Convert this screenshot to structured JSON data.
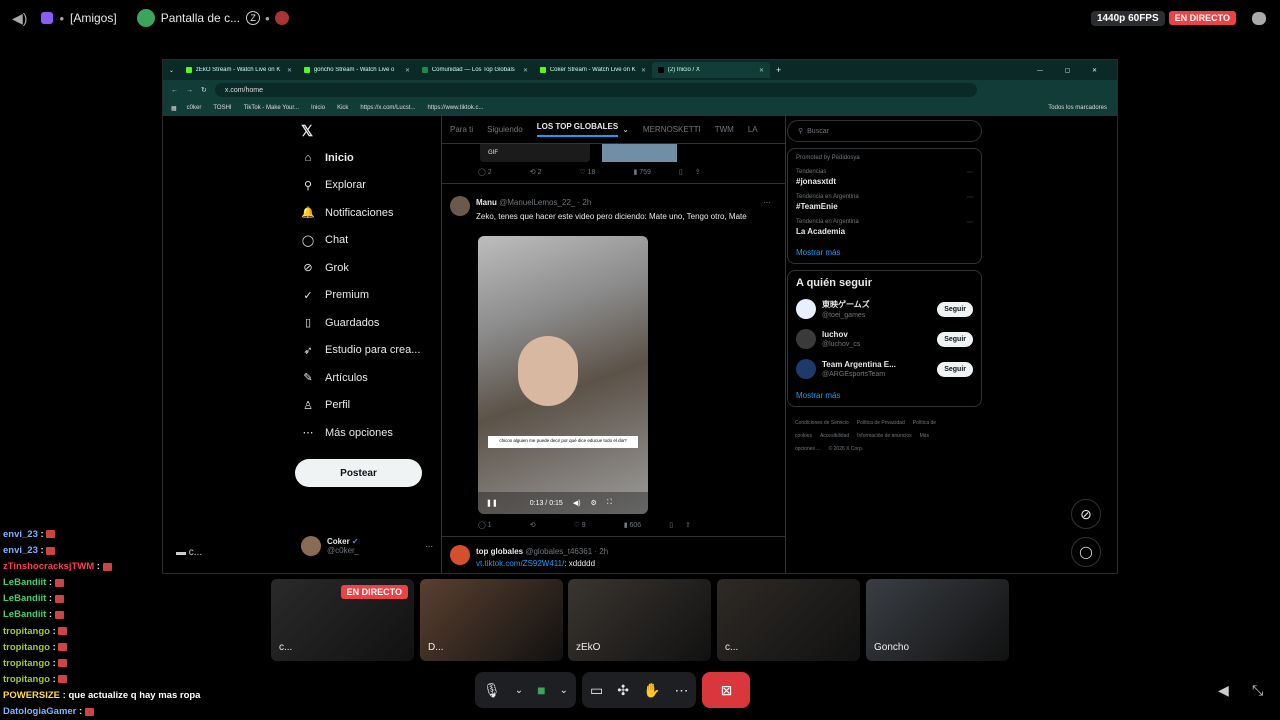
{
  "topbar": {
    "server": "[Amigos]",
    "channel": "Pantalla de c...",
    "quality": "1440p 60FPS",
    "live": "EN DIRECTO"
  },
  "browser": {
    "tabs": [
      {
        "label": "zEkO Stream - Watch Live on K",
        "fav": "#53fc18"
      },
      {
        "label": "goncho Stream - Watch Live o",
        "fav": "#53fc18"
      },
      {
        "label": "Comunidad — Los Top Globals",
        "fav": "#1a8a4a"
      },
      {
        "label": "Coker Stream - Watch Live on K",
        "fav": "#53fc18"
      },
      {
        "label": "(2) Inicio / X",
        "fav": "#000000"
      }
    ],
    "url": "x.com/home",
    "bookmarks": [
      "c0ker",
      "TOSHI",
      "TikTok - Make Your...",
      "Inicio",
      "Kick",
      "https://x.com/Lucst...",
      "https://www.tiktok.c..."
    ],
    "all_bookmarks": "Todos los marcadores"
  },
  "x": {
    "nav": [
      {
        "label": "Inicio",
        "icon": "home-icon",
        "glyph": "⌂"
      },
      {
        "label": "Explorar",
        "icon": "search-icon",
        "glyph": "⚲"
      },
      {
        "label": "Notificaciones",
        "icon": "bell-icon",
        "glyph": "🔔"
      },
      {
        "label": "Chat",
        "icon": "chat-icon",
        "glyph": "◯"
      },
      {
        "label": "Grok",
        "icon": "grok-icon",
        "glyph": "⊘"
      },
      {
        "label": "Premium",
        "icon": "premium-icon",
        "glyph": "✓"
      },
      {
        "label": "Guardados",
        "icon": "bookmark-icon",
        "glyph": "▯"
      },
      {
        "label": "Estudio para crea...",
        "icon": "rocket-icon",
        "glyph": "➶"
      },
      {
        "label": "Artículos",
        "icon": "article-icon",
        "glyph": "✎"
      },
      {
        "label": "Perfil",
        "icon": "profile-icon",
        "glyph": "♙"
      },
      {
        "label": "Más opciones",
        "icon": "more-icon",
        "glyph": "⋯"
      }
    ],
    "post_button": "Postear",
    "profile_name": "Coker",
    "profile_handle": "@c0ker_",
    "feed_tabs": [
      "Para ti",
      "Siguiendo",
      "LOS TOP GLOBALES",
      "MERNOSKETTI",
      "TWM",
      "LA"
    ],
    "active_tab": 2,
    "top_gif": "GIF",
    "top_actions": [
      "2",
      "2",
      "18",
      "759"
    ],
    "tweet1": {
      "name": "Manu",
      "handle": "@ManuelLemos_22_ · 2h",
      "text": "Zeko, tenes que hacer este video pero diciendo: Mate uno, Tengo otro, Mate",
      "caption": "chicos alguien me puede decir por qué dice educue todo el dia?",
      "time": "0:13 / 0:15",
      "actions": [
        "1",
        "",
        "9",
        "606"
      ]
    },
    "tweet2": {
      "name": "top globales",
      "handle": "@globales_t46361 · 2h",
      "link": "vt.tiktok.com/ZS92W411/",
      "text": ": xddddd"
    },
    "search_placeholder": "Buscar",
    "promoted": "Promoted by Pedidosya",
    "trends": [
      {
        "cat": "Tendencias",
        "tag": "#jonasxtdt"
      },
      {
        "cat": "Tendencia en Argentina",
        "tag": "#TeamEnie"
      },
      {
        "cat": "Tendencia en Argentina",
        "tag": "La Academia"
      }
    ],
    "show_more": "Mostrar más",
    "who_follow": "A quién seguir",
    "suggestions": [
      {
        "name": "東映ゲームズ",
        "handle": "@toei_games"
      },
      {
        "name": "luchov",
        "handle": "@luchov_cs"
      },
      {
        "name": "Team Argentina E...",
        "handle": "@ARGEsportsTeam"
      }
    ],
    "follow_label": "Seguir",
    "footer": [
      "Condiciones de Servicio",
      "Política de Privacidad",
      "Política de cookies",
      "Accesibilidad",
      "Información de anuncios",
      "Más opciones ...",
      "© 2026 X Corp."
    ]
  },
  "chat": [
    {
      "user": "envi_23",
      "color": "#7fb3ff",
      "msg": ""
    },
    {
      "user": "envi_23",
      "color": "#7fb3ff",
      "msg": ""
    },
    {
      "user": "zTinshocracksjTWM",
      "color": "#ff3b5c",
      "msg": ""
    },
    {
      "user": "LeBandiit",
      "color": "#3cd070",
      "msg": ""
    },
    {
      "user": "LeBandiit",
      "color": "#3cd070",
      "msg": ""
    },
    {
      "user": "LeBandiit",
      "color": "#3cd070",
      "msg": ""
    },
    {
      "user": "tropitango",
      "color": "#9acd32",
      "msg": ""
    },
    {
      "user": "tropitango",
      "color": "#9acd32",
      "msg": ""
    },
    {
      "user": "tropitango",
      "color": "#9acd32",
      "msg": ""
    },
    {
      "user": "tropitango",
      "color": "#9acd32",
      "msg": ""
    },
    {
      "user": "POWERSIZE",
      "color": "#ffd84a",
      "msg": "que actualize q hay mas ropa"
    },
    {
      "user": "DatologiaGamer",
      "color": "#7fb3ff",
      "msg": ""
    }
  ],
  "participants": [
    {
      "label": "c...",
      "live": "EN DIRECTO"
    },
    {
      "label": "D..."
    },
    {
      "label": "zEkO"
    },
    {
      "label": "c..."
    },
    {
      "label": "Goncho"
    }
  ],
  "side_participant": "c..."
}
